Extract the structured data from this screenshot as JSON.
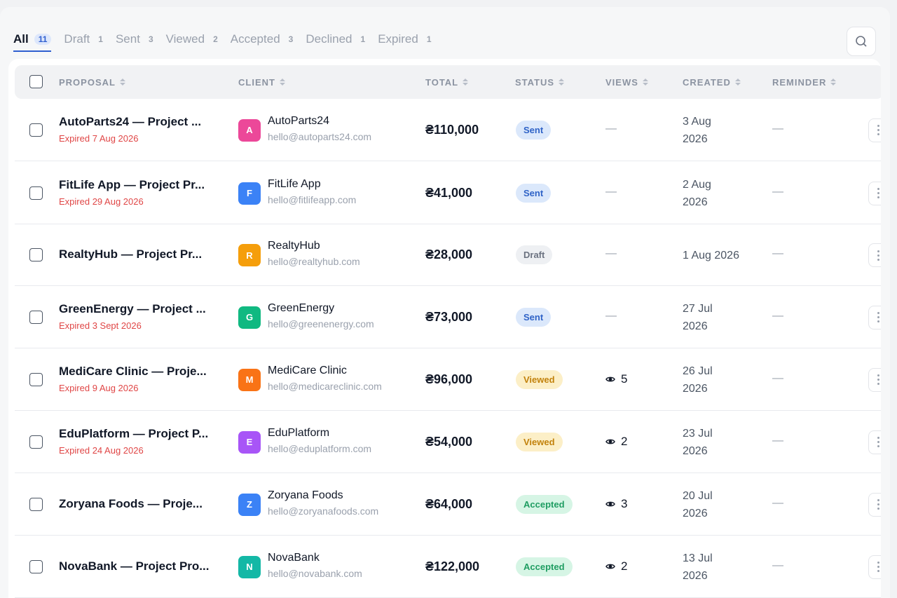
{
  "tabs": [
    {
      "label": "All",
      "count": "11",
      "active": true
    },
    {
      "label": "Draft",
      "count": "1"
    },
    {
      "label": "Sent",
      "count": "3"
    },
    {
      "label": "Viewed",
      "count": "2"
    },
    {
      "label": "Accepted",
      "count": "3"
    },
    {
      "label": "Declined",
      "count": "1"
    },
    {
      "label": "Expired",
      "count": "1"
    }
  ],
  "columns": {
    "proposal": "PROPOSAL",
    "client": "CLIENT",
    "total": "TOTAL",
    "status": "STATUS",
    "views": "VIEWS",
    "created": "CREATED",
    "reminder": "REMINDER"
  },
  "icons": {
    "search": "search-icon",
    "sort": "sort-icon",
    "eye": "eye-icon",
    "more": "more-vertical-icon"
  },
  "status_colors": {
    "Sent": {
      "bg": "#dbe8fb",
      "fg": "#2f63c7"
    },
    "Draft": {
      "bg": "#eef0f3",
      "fg": "#6b7280"
    },
    "Viewed": {
      "bg": "#fcefc7",
      "fg": "#c2820c"
    },
    "Accepted": {
      "bg": "#d6f5e5",
      "fg": "#1f9d62"
    }
  },
  "rows": [
    {
      "title": "AutoParts24 — Project ...",
      "expired": "Expired 7 Aug 2026",
      "initial": "A",
      "color": "#ec4899",
      "client": "AutoParts24",
      "email": "hello@autoparts24.com",
      "total": "₴110,000",
      "status": "Sent",
      "views": "—",
      "created1": "3 Aug",
      "created2": "2026",
      "reminder": "—"
    },
    {
      "title": "FitLife App — Project Pr...",
      "expired": "Expired 29 Aug 2026",
      "initial": "F",
      "color": "#3b82f6",
      "client": "FitLife App",
      "email": "hello@fitlifeapp.com",
      "total": "₴41,000",
      "status": "Sent",
      "views": "—",
      "created1": "2 Aug",
      "created2": "2026",
      "reminder": "—"
    },
    {
      "title": "RealtyHub — Project Pr...",
      "expired": "",
      "initial": "R",
      "color": "#f59e0b",
      "client": "RealtyHub",
      "email": "hello@realtyhub.com",
      "total": "₴28,000",
      "status": "Draft",
      "views": "—",
      "created1": "1 Aug 2026",
      "created2": "",
      "reminder": "—"
    },
    {
      "title": "GreenEnergy — Project ...",
      "expired": "Expired 3 Sept 2026",
      "initial": "G",
      "color": "#10b981",
      "client": "GreenEnergy",
      "email": "hello@greenenergy.com",
      "total": "₴73,000",
      "status": "Sent",
      "views": "—",
      "created1": "27 Jul",
      "created2": "2026",
      "reminder": "—"
    },
    {
      "title": "MediCare Clinic — Proje...",
      "expired": "Expired 9 Aug 2026",
      "initial": "M",
      "color": "#f97316",
      "client": "MediCare Clinic",
      "email": "hello@medicareclinic.com",
      "total": "₴96,000",
      "status": "Viewed",
      "views": "5",
      "created1": "26 Jul",
      "created2": "2026",
      "reminder": "—"
    },
    {
      "title": "EduPlatform — Project P...",
      "expired": "Expired 24 Aug 2026",
      "initial": "E",
      "color": "#a855f7",
      "client": "EduPlatform",
      "email": "hello@eduplatform.com",
      "total": "₴54,000",
      "status": "Viewed",
      "views": "2",
      "created1": "23 Jul",
      "created2": "2026",
      "reminder": "—"
    },
    {
      "title": "Zoryana Foods — Proje...",
      "expired": "",
      "initial": "Z",
      "color": "#3b82f6",
      "client": "Zoryana Foods",
      "email": "hello@zoryanafoods.com",
      "total": "₴64,000",
      "status": "Accepted",
      "views": "3",
      "created1": "20 Jul",
      "created2": "2026",
      "reminder": "—"
    },
    {
      "title": "NovaBank — Project Pro...",
      "expired": "",
      "initial": "N",
      "color": "#14b8a6",
      "client": "NovaBank",
      "email": "hello@novabank.com",
      "total": "₴122,000",
      "status": "Accepted",
      "views": "2",
      "created1": "13 Jul",
      "created2": "2026",
      "reminder": "—"
    }
  ]
}
